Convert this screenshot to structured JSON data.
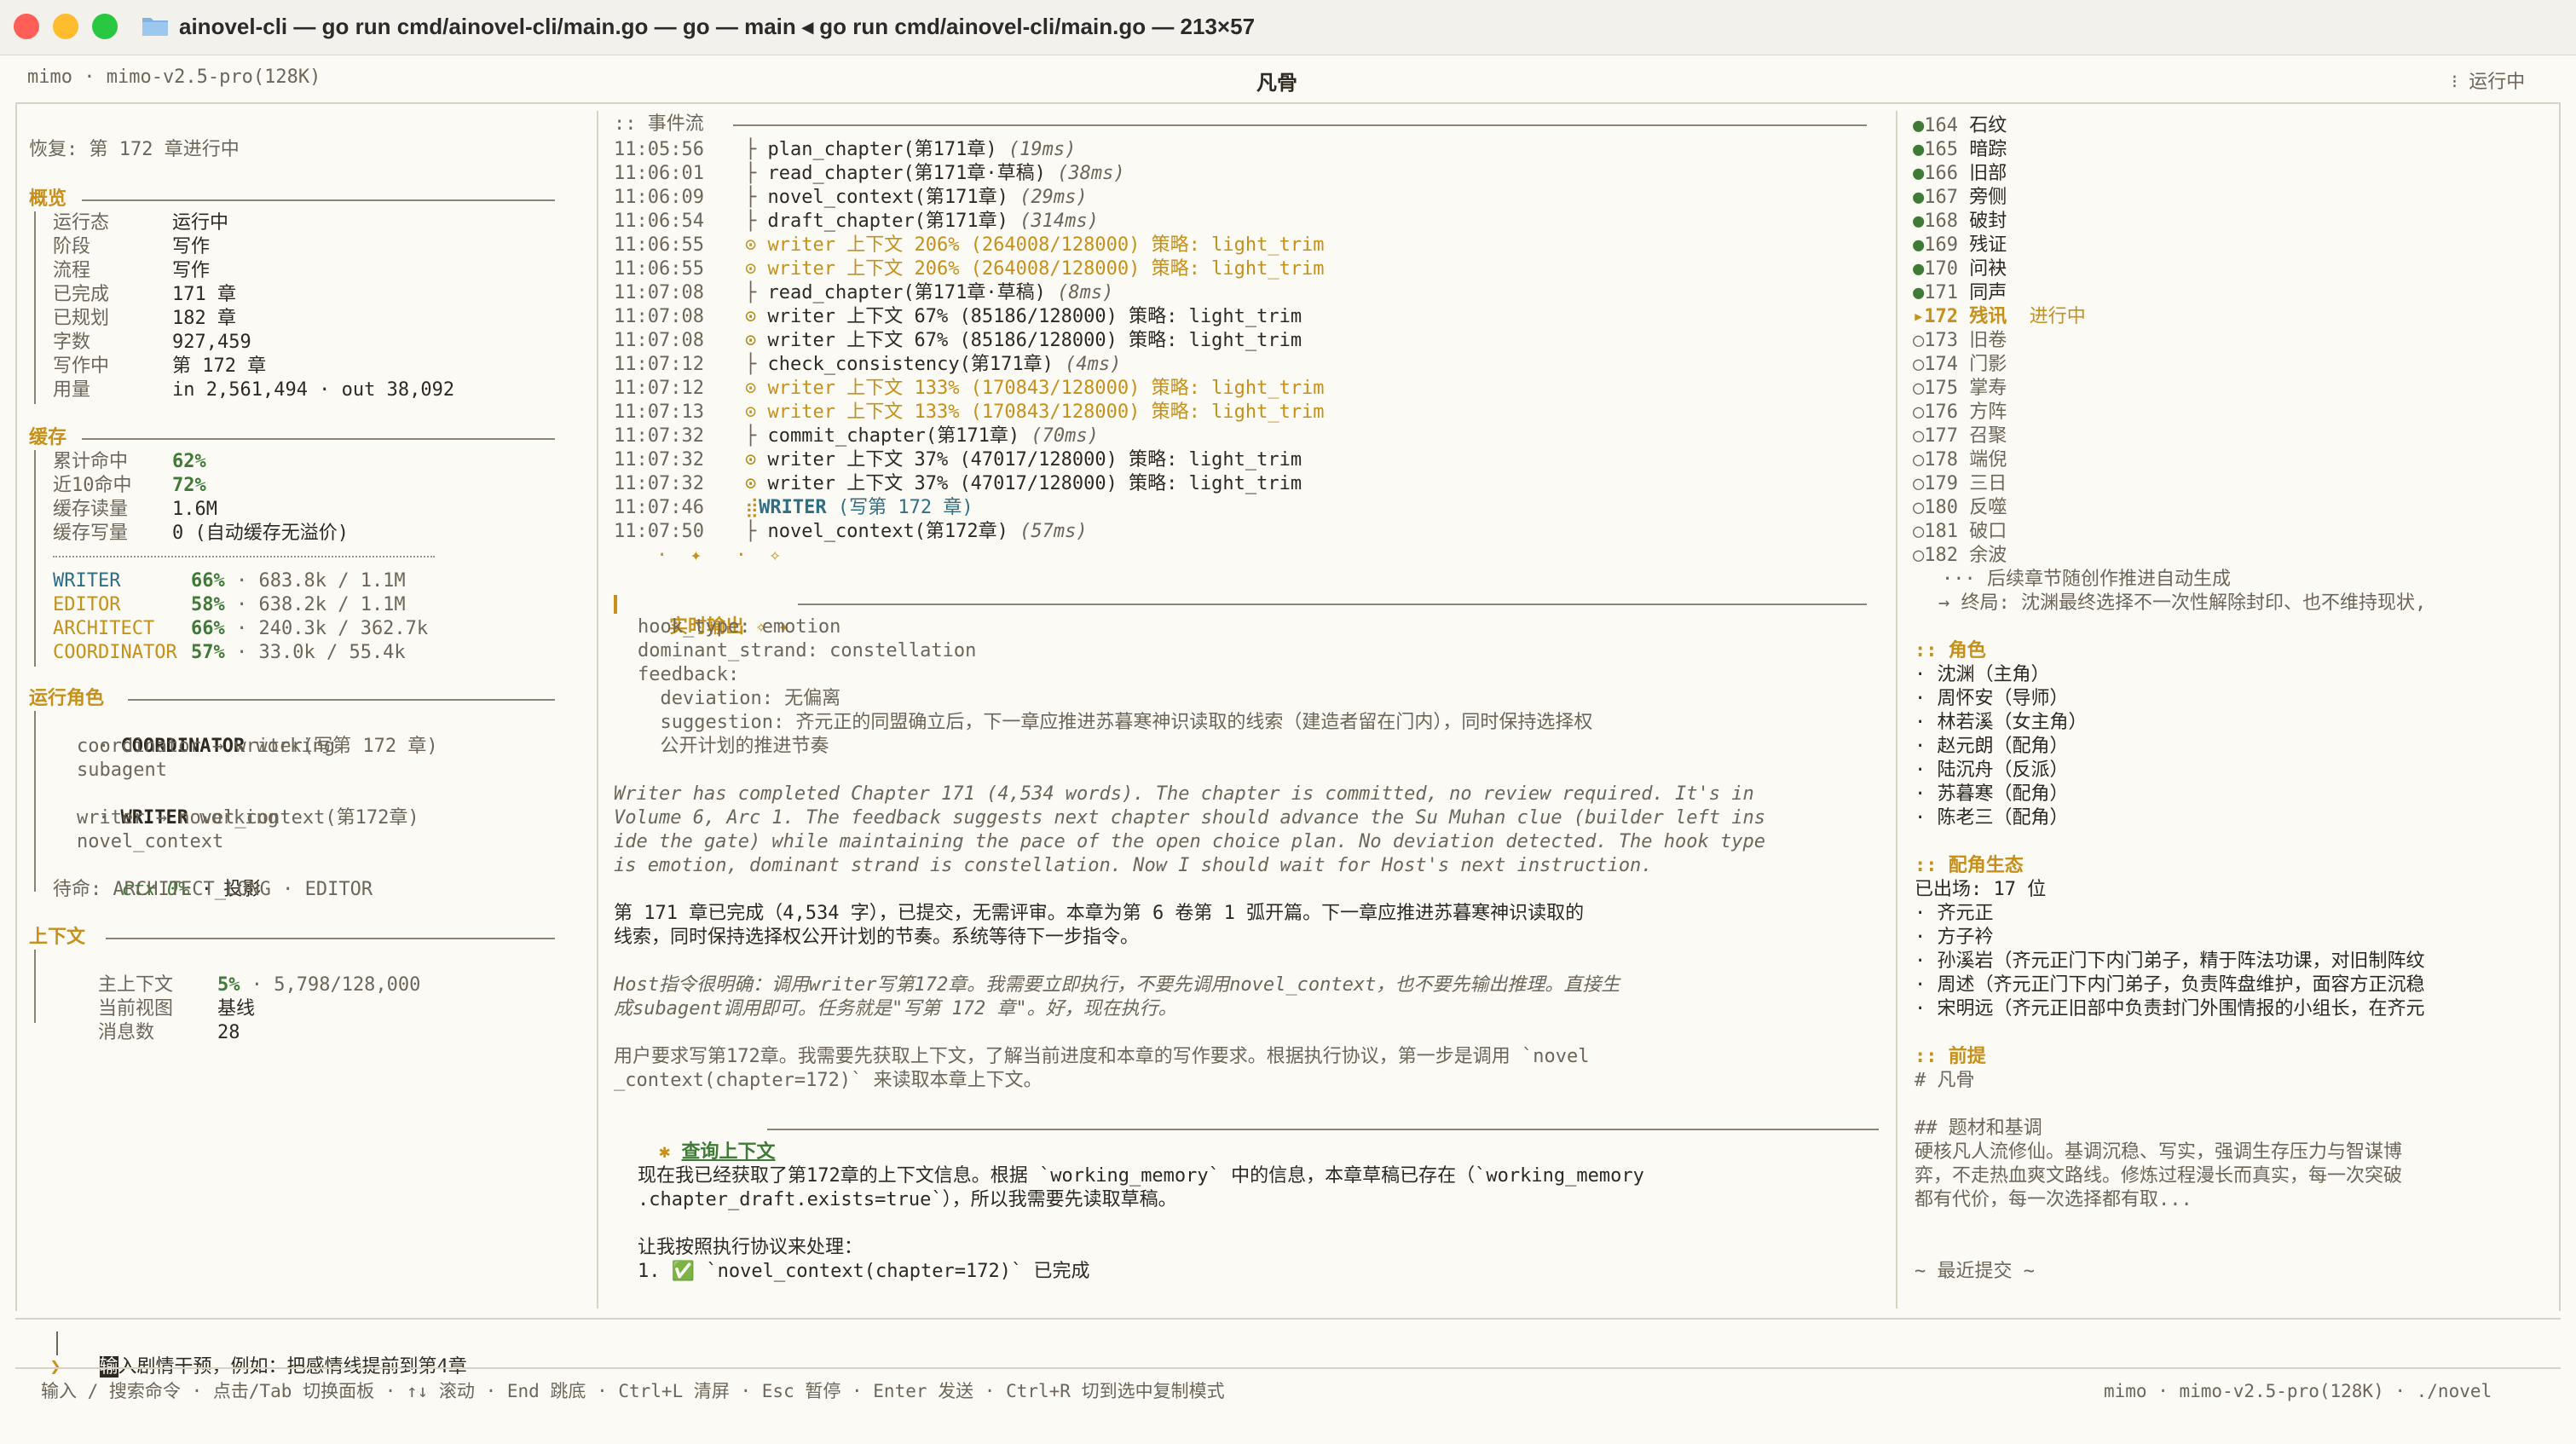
{
  "window": {
    "title": "ainovel-cli — go run cmd/ainovel-cli/main.go — go — main ◂ go run cmd/ainovel-cli/main.go — 213×57",
    "colors": {
      "close": "#ff5f57",
      "minimize": "#febc2e",
      "maximize": "#28c840",
      "accent": "#c6901a",
      "teal": "#2f6f86",
      "green": "#3f7a36"
    }
  },
  "header": {
    "left": "mimo · mimo-v2.5-pro(128K)",
    "center": "凡骨",
    "right": "⁝ 运行中"
  },
  "left": {
    "resume": "恢复: 第 172 章进行中",
    "overview_title": "概览",
    "overview": [
      {
        "k": "运行态",
        "v": "运行中"
      },
      {
        "k": "阶段",
        "v": "写作"
      },
      {
        "k": "流程",
        "v": "写作"
      },
      {
        "k": "已完成",
        "v": "171 章"
      },
      {
        "k": "已规划",
        "v": "182 章"
      },
      {
        "k": "字数",
        "v": "927,459"
      },
      {
        "k": "写作中",
        "v": "第 172 章"
      },
      {
        "k": "用量",
        "v": "in 2,561,494 · out 38,092"
      }
    ],
    "cache_title": "缓存",
    "cache": [
      {
        "k": "累计命中",
        "v": "62%"
      },
      {
        "k": "近10命中",
        "v": "72%"
      },
      {
        "k": "缓存读量",
        "v": "1.6M"
      },
      {
        "k": "缓存写量",
        "v": "0 (自动缓存无溢价)"
      }
    ],
    "agents": [
      {
        "name": "WRITER",
        "pct": "66%",
        "rest": "· 683.8k / 1.1M"
      },
      {
        "name": "EDITOR",
        "pct": "58%",
        "rest": "· 638.2k / 1.1M"
      },
      {
        "name": "ARCHITECT",
        "pct": "66%",
        "rest": "· 240.3k / 362.7k"
      },
      {
        "name": "COORDINATOR",
        "pct": "57%",
        "rest": "· 33.0k / 55.4k"
      }
    ],
    "roles_title": "运行角色",
    "roles": {
      "coord_name": "COORDINATOR",
      "coord_state": "working",
      "coord_l1": "coordinator → writer(写第 172 章)",
      "coord_l2": "subagent",
      "writer_name": "WRITER",
      "writer_state": "working",
      "writer_l1": "writer → novel_context(第172章)",
      "writer_l2": "novel_context",
      "writer_ctx": "ctx 0%",
      "writer_ctx_rest": "· 投影",
      "waiting": "待命: ARCHITECT_LONG · EDITOR"
    },
    "context_title": "上下文",
    "context": {
      "main_k": "主上下文",
      "main_pct": "5%",
      "main_rest": "· 5,798/128,000",
      "view_k": "当前视图",
      "view_v": "基线",
      "msg_k": "消息数",
      "msg_v": "28"
    }
  },
  "center": {
    "events_title": ":: 事件流",
    "events": [
      {
        "t": "11:05:56",
        "kind": "tool",
        "name": "plan_chapter(第171章)",
        "dur": "(19ms)"
      },
      {
        "t": "11:06:01",
        "kind": "tool",
        "name": "read_chapter(第171章·草稿)",
        "dur": "(38ms)"
      },
      {
        "t": "11:06:09",
        "kind": "tool",
        "name": "novel_context(第171章)",
        "dur": "(29ms)"
      },
      {
        "t": "11:06:54",
        "kind": "tool",
        "name": "draft_chapter(第171章)",
        "dur": "(314ms)"
      },
      {
        "t": "11:06:55",
        "kind": "warn",
        "name": "writer 上下文 206% (264008/128000) 策略: light_trim",
        "dur": ""
      },
      {
        "t": "11:06:55",
        "kind": "warn",
        "name": "writer 上下文 206% (264008/128000) 策略: light_trim",
        "dur": ""
      },
      {
        "t": "11:07:08",
        "kind": "tool",
        "name": "read_chapter(第171章·草稿)",
        "dur": "(8ms)"
      },
      {
        "t": "11:07:08",
        "kind": "info",
        "name": "writer 上下文 67% (85186/128000) 策略: light_trim",
        "dur": ""
      },
      {
        "t": "11:07:08",
        "kind": "info",
        "name": "writer 上下文 67% (85186/128000) 策略: light_trim",
        "dur": ""
      },
      {
        "t": "11:07:12",
        "kind": "tool",
        "name": "check_consistency(第171章)",
        "dur": "(4ms)"
      },
      {
        "t": "11:07:12",
        "kind": "warn",
        "name": "writer 上下文 133% (170843/128000) 策略: light_trim",
        "dur": ""
      },
      {
        "t": "11:07:13",
        "kind": "warn",
        "name": "writer 上下文 133% (170843/128000) 策略: light_trim",
        "dur": ""
      },
      {
        "t": "11:07:32",
        "kind": "tool",
        "name": "commit_chapter(第171章)",
        "dur": "(70ms)"
      },
      {
        "t": "11:07:32",
        "kind": "info",
        "name": "writer 上下文 37% (47017/128000) 策略: light_trim",
        "dur": ""
      },
      {
        "t": "11:07:32",
        "kind": "info",
        "name": "writer 上下文 37% (47017/128000) 策略: light_trim",
        "dur": ""
      },
      {
        "t": "11:07:46",
        "kind": "agent",
        "name": "WRITER",
        "dur": "(写第 172 章)"
      },
      {
        "t": "11:07:50",
        "kind": "tool",
        "name": "novel_context(第172章)",
        "dur": "(57ms)"
      }
    ],
    "spinner": "·  ✦   ·  ✧",
    "live_title": "实时输出",
    "live_sparks": "✧ ✦",
    "live_lines": [
      "hook_type: emotion",
      "dominant_strand: constellation",
      "feedback:",
      "  deviation: 无偏离",
      "  suggestion: 齐元正的同盟确立后，下一章应推进苏暮寒神识读取的线索（建造者留在门内），同时保持选择权",
      "  公开计划的推进节奏"
    ],
    "english_para": [
      "Writer has completed Chapter 171 (4,534 words). The chapter is committed, no review required. It's in",
      "Volume 6, Arc 1. The feedback suggests next chapter should advance the Su Muhan clue (builder left ins",
      "ide the gate) while maintaining the pace of the open choice plan. No deviation detected. The hook type",
      "is emotion, dominant strand is constellation. Now I should wait for Host's next instruction."
    ],
    "cn_para": [
      "第 171 章已完成（4,534 字），已提交，无需评审。本章为第 6 卷第 1 弧开篇。下一章应推进苏暮寒神识读取的",
      "线索，同时保持选择权公开计划的节奏。系统等待下一步指令。"
    ],
    "host_para": [
      "Host指令很明确：调用writer写第172章。我需要立即执行，不要先调用novel_context，也不要先输出推理。直接生",
      "成subagent调用即可。任务就是\"写第 172 章\"。好，现在执行。"
    ],
    "user_para": [
      "用户要求写第172章。我需要先获取上下文，了解当前进度和本章的写作要求。根据执行协议，第一步是调用 `novel",
      "_context(chapter=172)` 来读取本章上下文。"
    ],
    "query_title": "查询上下文",
    "query_lines": [
      "现在我已经获取了第172章的上下文信息。根据 `working_memory` 中的信息，本章草稿已存在（`working_memory",
      ".chapter_draft.exists=true`），所以我需要先读取草稿。",
      "",
      "让我按照执行协议来处理：",
      "1. ✅ `novel_context(chapter=172)` 已完成"
    ]
  },
  "right": {
    "chapters": [
      {
        "state": "done",
        "no": "164",
        "name": "石纹"
      },
      {
        "state": "done",
        "no": "165",
        "name": "暗踪"
      },
      {
        "state": "done",
        "no": "166",
        "name": "旧部"
      },
      {
        "state": "done",
        "no": "167",
        "name": "旁侧"
      },
      {
        "state": "done",
        "no": "168",
        "name": "破封"
      },
      {
        "state": "done",
        "no": "169",
        "name": "残证"
      },
      {
        "state": "done",
        "no": "170",
        "name": "问袂"
      },
      {
        "state": "done",
        "no": "171",
        "name": "同声"
      },
      {
        "state": "current",
        "no": "172",
        "name": "残讯",
        "note": "进行中"
      },
      {
        "state": "todo",
        "no": "173",
        "name": "旧卷"
      },
      {
        "state": "todo",
        "no": "174",
        "name": "门影"
      },
      {
        "state": "todo",
        "no": "175",
        "name": "掌寿"
      },
      {
        "state": "todo",
        "no": "176",
        "name": "方阵"
      },
      {
        "state": "todo",
        "no": "177",
        "name": "召聚"
      },
      {
        "state": "todo",
        "no": "178",
        "name": "端倪"
      },
      {
        "state": "todo",
        "no": "179",
        "name": "三日"
      },
      {
        "state": "todo",
        "no": "180",
        "name": "反噬"
      },
      {
        "state": "todo",
        "no": "181",
        "name": "破口"
      },
      {
        "state": "todo",
        "no": "182",
        "name": "余波"
      }
    ],
    "more": "··· 后续章节随创作推进自动生成",
    "ending": "→ 终局: 沈渊最终选择不一次性解除封印、也不维持现状,",
    "roles_title": ":: 角色",
    "roles": [
      "· 沈渊（主角）",
      "· 周怀安（导师）",
      "· 林若溪（女主角）",
      "· 赵元朗（配角）",
      "· 陆沉舟（反派）",
      "· 苏暮寒（配角）",
      "· 陈老三（配角）"
    ],
    "eco_title": ":: 配角生态",
    "eco": [
      "已出场: 17 位",
      "· 齐元正",
      "· 方子衿",
      "· 孙溪岩（齐元正门下内门弟子，精于阵法功课，对旧制阵纹",
      "· 周述（齐元正门下内门弟子，负责阵盘维护，面容方正沉稳",
      "· 宋明远（齐元正旧部中负责封门外围情报的小组长，在齐元"
    ],
    "premise_title": ":: 前提",
    "premise": [
      "# 凡骨",
      "",
      "## 题材和基调",
      "硬核凡人流修仙。基调沉稳、写实，强调生存压力与智谋博",
      "弈，不走热血爽文路线。修炼过程漫长而真实，每一次突破",
      "都有代价，每一次选择都有取...",
      "",
      "",
      "~ 最近提交 ~"
    ]
  },
  "input": {
    "prompt": "❯",
    "cursor_char": "输",
    "placeholder": "入剧情干预，例如：把感情线提前到第4章"
  },
  "footer": {
    "hints": "输入 / 搜索命令 · 点击/Tab 切换面板 · ↑↓ 滚动 · End 跳底 · Ctrl+L 清屏 · Esc 暂停 · Enter 发送 · Ctrl+R 切到选中复制模式",
    "right": "mimo · mimo-v2.5-pro(128K) · ./novel"
  }
}
